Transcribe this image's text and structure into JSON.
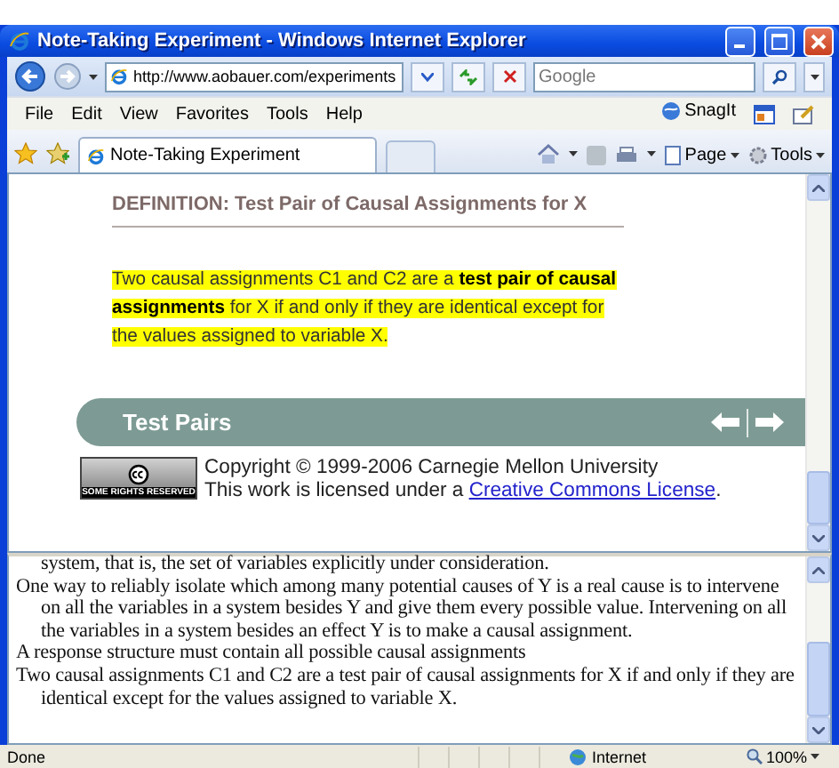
{
  "window": {
    "title": "Note-Taking Experiment - Windows Internet Explorer"
  },
  "address_bar": {
    "value": "http://www.aobauer.com/experiments"
  },
  "search": {
    "placeholder": "Google"
  },
  "menu": [
    "File",
    "Edit",
    "View",
    "Favorites",
    "Tools",
    "Help"
  ],
  "snagit": {
    "label": "SnagIt"
  },
  "tabs": [
    {
      "label": "Note-Taking Experiment",
      "selected": true
    }
  ],
  "command_bar": [
    "Page",
    "Tools"
  ],
  "content": {
    "heading": "DEFINITION: Test Pair of Causal Assignments for X",
    "definition": "Two causal assignments C1 and C2 are a **test pair of causal assignments** for X if and only if they are identical except for the values assigned to variable X.",
    "nav_bar": {
      "title": "Test Pairs"
    },
    "license_badge": "SOME RIGHTS RESERVED",
    "copyright": "Copyright © 1999-2006 Carnegie Mellon University",
    "license_text": "This work is licensed under a",
    "license_link": "Creative Commons License",
    "license_end": "."
  },
  "notes": [
    {
      "kind": "continuation",
      "text": "system, that is, the set of variables explicitly under consideration."
    },
    {
      "kind": "entry",
      "text": "One way to reliably isolate which among many potential causes of Y is a real cause is to intervene on all the variables in a system besides Y and give them every possible value. Intervening on all the variables in a system besides an effect Y is to make a causal assignment."
    },
    {
      "kind": "entry",
      "text": "A response structure must contain all possible causal assignments"
    },
    {
      "kind": "entry",
      "text": "Two causal assignments C1 and C2 are a test pair of causal assignments for X if and only if they are identical except for the values assigned to variable X."
    }
  ],
  "status_bar": {
    "text": "Done",
    "zone": "Internet",
    "zoom": "100%"
  }
}
